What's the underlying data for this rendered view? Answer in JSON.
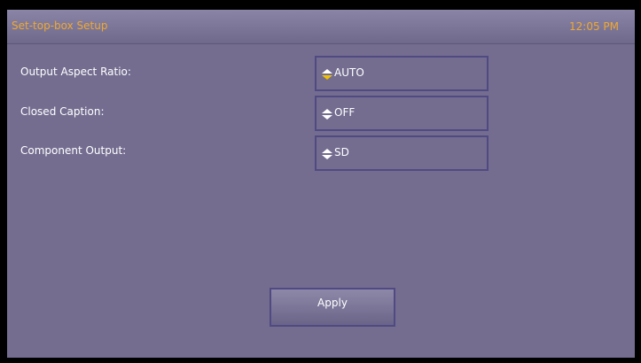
{
  "header": {
    "title": "Set-top-box Setup",
    "time": "12:05 PM"
  },
  "settings": [
    {
      "label": "Output Aspect Ratio:",
      "value": "AUTO",
      "focused": true
    },
    {
      "label": "Closed Caption:",
      "value": "OFF",
      "focused": false
    },
    {
      "label": "Component Output:",
      "value": "SD",
      "focused": false
    }
  ],
  "apply_label": "Apply",
  "colors": {
    "accent": "#f0a830",
    "background": "#746d90",
    "field_border": "#4f4a82",
    "focus_arrow": "#f0c000"
  }
}
